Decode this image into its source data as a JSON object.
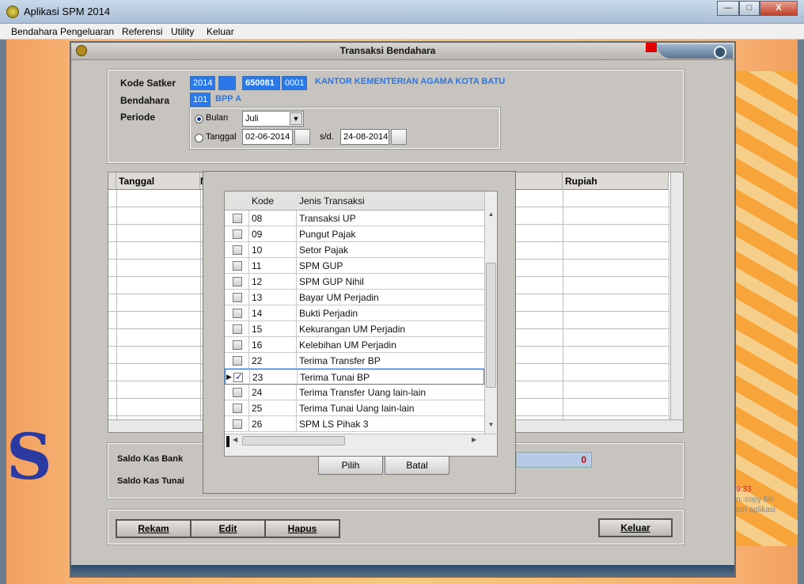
{
  "window": {
    "title": "Aplikasi SPM 2014",
    "min_label": "—",
    "max_label": "□",
    "close_label": "X"
  },
  "menu": [
    {
      "label": "Bendahara Pengeluaran"
    },
    {
      "label": "Referensi"
    },
    {
      "label": "Utility"
    },
    {
      "label": "Keluar"
    }
  ],
  "background_hint": {
    "time": "9:33",
    "line1": "n, copy file",
    "line2": "tori aplikasi"
  },
  "form": {
    "title": "Transaksi Bendahara",
    "kode_satker_label": "Kode Satker",
    "kode_satker": {
      "year": "2014",
      "blank": "",
      "code": "650081",
      "sub": "0001",
      "name": "KANTOR KEMENTERIAN AGAMA KOTA BATU"
    },
    "bendahara_label": "Bendahara",
    "bendahara": {
      "code": "101",
      "name": "BPP A"
    },
    "periode_label": "Periode",
    "periode": {
      "bulan_label": "Bulan",
      "bulan_value": "Juli",
      "bulan_selected": true,
      "tanggal_label": "Tanggal",
      "tanggal_from": "02-06-2014",
      "sd_label": "s/d.",
      "tanggal_to": "24-08-2014"
    },
    "grid": {
      "col_tanggal": "Tanggal",
      "col_n": "N",
      "col_rupiah": "Rupiah"
    },
    "saldo": {
      "bank_label": "Saldo Kas Bank",
      "tunai_label": "Saldo Kas Tunai",
      "bank_value": "0"
    },
    "buttons": {
      "rekam": "Rekam",
      "edit": "Edit",
      "hapus": "Hapus",
      "keluar": "Keluar"
    }
  },
  "popup": {
    "col_kode": "Kode",
    "col_jenis": "Jenis Transaksi",
    "rows": [
      {
        "kode": "08",
        "jenis": "Transaksi UP",
        "checked": false
      },
      {
        "kode": "09",
        "jenis": "Pungut Pajak",
        "checked": false
      },
      {
        "kode": "10",
        "jenis": "Setor Pajak",
        "checked": false
      },
      {
        "kode": "11",
        "jenis": "SPM GUP",
        "checked": false
      },
      {
        "kode": "12",
        "jenis": "SPM GUP Nihil",
        "checked": false
      },
      {
        "kode": "13",
        "jenis": "Bayar UM Perjadin",
        "checked": false
      },
      {
        "kode": "14",
        "jenis": "Bukti Perjadin",
        "checked": false
      },
      {
        "kode": "15",
        "jenis": "Kekurangan UM Perjadin",
        "checked": false
      },
      {
        "kode": "16",
        "jenis": "Kelebihan UM Perjadin",
        "checked": false
      },
      {
        "kode": "22",
        "jenis": "Terima Transfer BP",
        "checked": false
      },
      {
        "kode": "23",
        "jenis": "Terima Tunai BP",
        "checked": true
      },
      {
        "kode": "24",
        "jenis": "Terima Transfer Uang lain-lain",
        "checked": false
      },
      {
        "kode": "25",
        "jenis": "Terima Tunai Uang lain-lain",
        "checked": false
      },
      {
        "kode": "26",
        "jenis": "SPM LS Pihak 3",
        "checked": false
      }
    ],
    "pilih_label": "Pilih",
    "batal_label": "Batal",
    "colors": {
      "selected_border": "#3b78d8",
      "accent": "#2b79e8"
    }
  }
}
